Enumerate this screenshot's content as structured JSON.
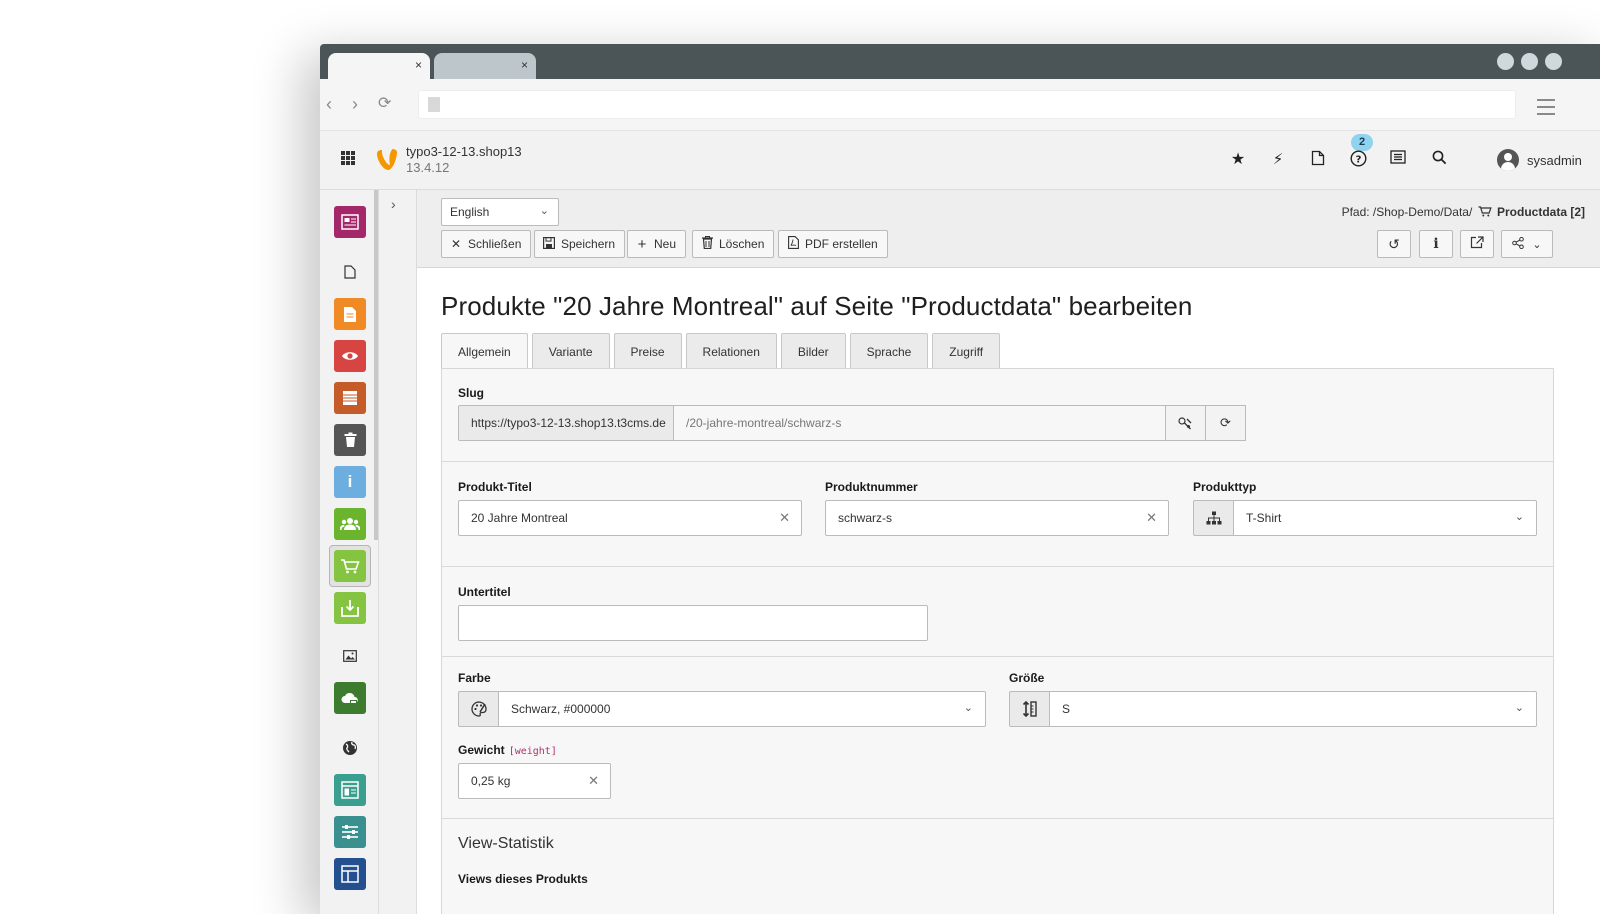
{
  "browser": {
    "tabs": [
      {
        "close": "×"
      },
      {
        "close": "×"
      }
    ]
  },
  "typo3": {
    "site_name": "typo3-12-13.shop13",
    "version": "13.4.12",
    "opendocs_count": "2",
    "username": "sysadmin"
  },
  "docheader": {
    "language": "English",
    "path_prefix": "Pfad: /Shop-Demo/Data/",
    "path_current": "Productdata [2]",
    "buttons": {
      "close": "Schließen",
      "save": "Speichern",
      "new": "Neu",
      "delete": "Löschen",
      "pdf": "PDF erstellen"
    }
  },
  "form": {
    "title": "Produkte \"20 Jahre Montreal\" auf Seite \"Productdata\" bearbeiten",
    "tabs": [
      "Allgemein",
      "Variante",
      "Preise",
      "Relationen",
      "Bilder",
      "Sprache",
      "Zugriff"
    ],
    "slug": {
      "label": "Slug",
      "prefix": "https://typo3-12-13.shop13.t3cms.de",
      "value": "/20-jahre-montreal/schwarz-s"
    },
    "product_title": {
      "label": "Produkt-Titel",
      "value": "20 Jahre Montreal"
    },
    "product_number": {
      "label": "Produktnummer",
      "value": "schwarz-s"
    },
    "product_type": {
      "label": "Produkttyp",
      "value": "T-Shirt"
    },
    "subtitle": {
      "label": "Untertitel",
      "value": ""
    },
    "color": {
      "label": "Farbe",
      "value": "Schwarz, #000000"
    },
    "size": {
      "label": "Größe",
      "value": "S"
    },
    "weight": {
      "label": "Gewicht",
      "field_name": "[weight]",
      "value": "0,25 kg"
    },
    "stats": {
      "heading": "View-Statistik",
      "label": "Views dieses Produkts"
    }
  },
  "colors": {
    "mod_web": "#a4276a",
    "mod_page": "#f08a24",
    "mod_view": "#d64541",
    "mod_list": "#c65b2a",
    "mod_recycler": "#555555",
    "mod_info": "#6daee0",
    "mod_users": "#6bb42d",
    "mod_shop": "#85c441",
    "mod_import": "#85c441",
    "mod_cloud": "#3d7b2f",
    "mod_form": "#3a9f8f",
    "mod_config": "#3a8f8f",
    "mod_layout": "#25508f",
    "typo3_logo": "#f49700"
  }
}
